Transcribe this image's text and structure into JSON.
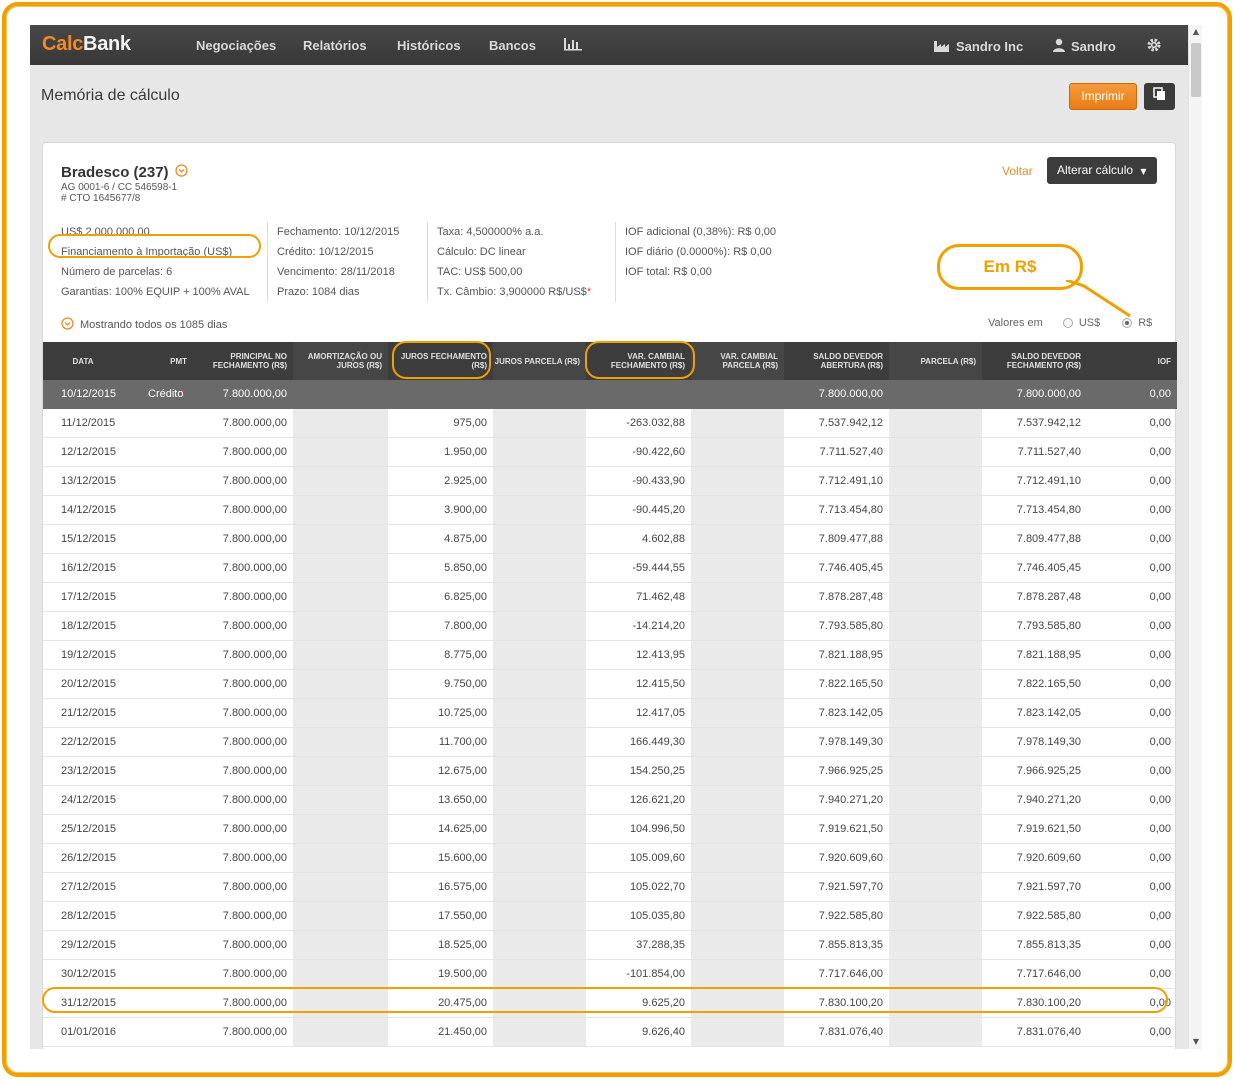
{
  "nav": {
    "brand_part1": "Calc",
    "brand_part2": "Bank",
    "items": [
      "Negociações",
      "Relatórios",
      "Históricos",
      "Bancos"
    ],
    "company": "Sandro Inc",
    "user": "Sandro",
    "icons": [
      "chart-bars-icon",
      "factory-icon",
      "user-icon",
      "gear-icon"
    ]
  },
  "page": {
    "title": "Memória de cálculo",
    "print_label": "Imprimir"
  },
  "panel": {
    "bank_name": "Bradesco (237)",
    "agency": "AG 0001-6 / CC 546598-1",
    "contract": "# CTO 1645677/8",
    "back_label": "Voltar",
    "alter_label": "Alterar cálculo",
    "info": {
      "col1": [
        "US$ 2.000.000,00",
        "Financiamento à Importação (US$)",
        "Número de parcelas: 6",
        "Garantias: 100% EQUIP + 100% AVAL"
      ],
      "col2": [
        "Fechamento: 10/12/2015",
        "Crédito: 10/12/2015",
        "Vencimento: 28/11/2018",
        "Prazo: 1084 dias"
      ],
      "col3": [
        "Taxa: 4,500000% a.a.",
        "Cálculo: DC linear",
        "TAC: US$ 500,00",
        "Tx. Câmbio: 3,900000 R$/US$"
      ],
      "col4": [
        "IOF adicional (0,38%): R$ 0,00",
        "IOF diário (0.0000%): R$ 0,00",
        "IOF total: R$ 0,00"
      ]
    },
    "showing": "Mostrando todos os 1085 dias",
    "values_label": "Valores em",
    "currency_usd": "US$",
    "currency_brl": "R$",
    "selected_currency": "R$"
  },
  "annotation": {
    "callout": "Em R$"
  },
  "table": {
    "headers": [
      "DATA",
      "PMT",
      "PRINCIPAL NO FECHAMENTO (R$)",
      "AMORTIZAÇÃO OU JUROS (R$)",
      "JUROS FECHAMENTO (R$)",
      "JUROS PARCELA (R$)",
      "VAR. CAMBIAL FECHAMENTO (R$)",
      "VAR. CAMBIAL PARCELA (R$)",
      "SALDO DEVEDOR ABERTURA (R$)",
      "PARCELA (R$)",
      "SALDO DEVEDOR FECHAMENTO (R$)",
      "IOF"
    ],
    "rows": [
      [
        "10/12/2015",
        "Crédito",
        "7.800.000,00",
        "",
        "",
        "",
        "",
        "",
        "7.800.000,00",
        "",
        "7.800.000,00",
        "0,00"
      ],
      [
        "11/12/2015",
        "",
        "7.800.000,00",
        "",
        "975,00",
        "",
        "-263.032,88",
        "",
        "7.537.942,12",
        "",
        "7.537.942,12",
        "0,00"
      ],
      [
        "12/12/2015",
        "",
        "7.800.000,00",
        "",
        "1.950,00",
        "",
        "-90.422,60",
        "",
        "7.711.527,40",
        "",
        "7.711.527,40",
        "0,00"
      ],
      [
        "13/12/2015",
        "",
        "7.800.000,00",
        "",
        "2.925,00",
        "",
        "-90.433,90",
        "",
        "7.712.491,10",
        "",
        "7.712.491,10",
        "0,00"
      ],
      [
        "14/12/2015",
        "",
        "7.800.000,00",
        "",
        "3.900,00",
        "",
        "-90.445,20",
        "",
        "7.713.454,80",
        "",
        "7.713.454,80",
        "0,00"
      ],
      [
        "15/12/2015",
        "",
        "7.800.000,00",
        "",
        "4.875,00",
        "",
        "4.602,88",
        "",
        "7.809.477,88",
        "",
        "7.809.477,88",
        "0,00"
      ],
      [
        "16/12/2015",
        "",
        "7.800.000,00",
        "",
        "5.850,00",
        "",
        "-59.444,55",
        "",
        "7.746.405,45",
        "",
        "7.746.405,45",
        "0,00"
      ],
      [
        "17/12/2015",
        "",
        "7.800.000,00",
        "",
        "6.825,00",
        "",
        "71.462,48",
        "",
        "7.878.287,48",
        "",
        "7.878.287,48",
        "0,00"
      ],
      [
        "18/12/2015",
        "",
        "7.800.000,00",
        "",
        "7.800,00",
        "",
        "-14.214,20",
        "",
        "7.793.585,80",
        "",
        "7.793.585,80",
        "0,00"
      ],
      [
        "19/12/2015",
        "",
        "7.800.000,00",
        "",
        "8.775,00",
        "",
        "12.413,95",
        "",
        "7.821.188,95",
        "",
        "7.821.188,95",
        "0,00"
      ],
      [
        "20/12/2015",
        "",
        "7.800.000,00",
        "",
        "9.750,00",
        "",
        "12.415,50",
        "",
        "7.822.165,50",
        "",
        "7.822.165,50",
        "0,00"
      ],
      [
        "21/12/2015",
        "",
        "7.800.000,00",
        "",
        "10.725,00",
        "",
        "12.417,05",
        "",
        "7.823.142,05",
        "",
        "7.823.142,05",
        "0,00"
      ],
      [
        "22/12/2015",
        "",
        "7.800.000,00",
        "",
        "11.700,00",
        "",
        "166.449,30",
        "",
        "7.978.149,30",
        "",
        "7.978.149,30",
        "0,00"
      ],
      [
        "23/12/2015",
        "",
        "7.800.000,00",
        "",
        "12.675,00",
        "",
        "154.250,25",
        "",
        "7.966.925,25",
        "",
        "7.966.925,25",
        "0,00"
      ],
      [
        "24/12/2015",
        "",
        "7.800.000,00",
        "",
        "13.650,00",
        "",
        "126.621,20",
        "",
        "7.940.271,20",
        "",
        "7.940.271,20",
        "0,00"
      ],
      [
        "25/12/2015",
        "",
        "7.800.000,00",
        "",
        "14.625,00",
        "",
        "104.996,50",
        "",
        "7.919.621,50",
        "",
        "7.919.621,50",
        "0,00"
      ],
      [
        "26/12/2015",
        "",
        "7.800.000,00",
        "",
        "15.600,00",
        "",
        "105.009,60",
        "",
        "7.920.609,60",
        "",
        "7.920.609,60",
        "0,00"
      ],
      [
        "27/12/2015",
        "",
        "7.800.000,00",
        "",
        "16.575,00",
        "",
        "105.022,70",
        "",
        "7.921.597,70",
        "",
        "7.921.597,70",
        "0,00"
      ],
      [
        "28/12/2015",
        "",
        "7.800.000,00",
        "",
        "17.550,00",
        "",
        "105.035,80",
        "",
        "7.922.585,80",
        "",
        "7.922.585,80",
        "0,00"
      ],
      [
        "29/12/2015",
        "",
        "7.800.000,00",
        "",
        "18.525,00",
        "",
        "37.288,35",
        "",
        "7.855.813,35",
        "",
        "7.855.813,35",
        "0,00"
      ],
      [
        "30/12/2015",
        "",
        "7.800.000,00",
        "",
        "19.500,00",
        "",
        "-101.854,00",
        "",
        "7.717.646,00",
        "",
        "7.717.646,00",
        "0,00"
      ],
      [
        "31/12/2015",
        "",
        "7.800.000,00",
        "",
        "20.475,00",
        "",
        "9.625,20",
        "",
        "7.830.100,20",
        "",
        "7.830.100,20",
        "0,00"
      ],
      [
        "01/01/2016",
        "",
        "7.800.000,00",
        "",
        "21.450,00",
        "",
        "9.626,40",
        "",
        "7.831.076,40",
        "",
        "7.831.076,40",
        "0,00"
      ]
    ]
  },
  "colors": {
    "accent": "#f08a24",
    "nav_bg": "#3f3f3f",
    "highlight": "#f0a000"
  }
}
